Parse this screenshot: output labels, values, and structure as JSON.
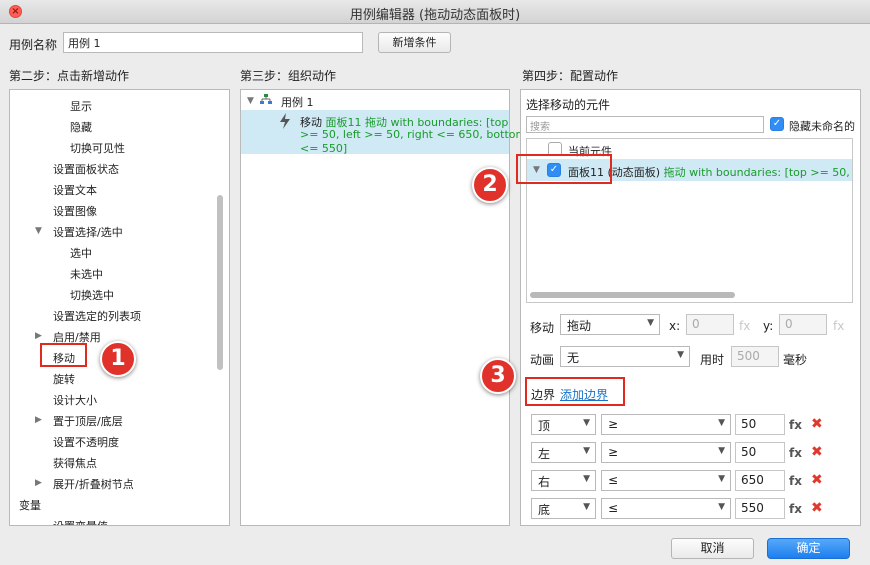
{
  "window": {
    "title": "用例编辑器 (拖动动态面板时)"
  },
  "header": {
    "name_label": "用例名称",
    "name_value": "用例 1",
    "add_condition": "新增条件"
  },
  "step2": {
    "heading": "第二步：点击新增动作",
    "items": [
      {
        "label": "显示",
        "indent": 2
      },
      {
        "label": "隐藏",
        "indent": 2
      },
      {
        "label": "切换可见性",
        "indent": 2
      },
      {
        "label": "设置面板状态",
        "indent": 1
      },
      {
        "label": "设置文本",
        "indent": 1
      },
      {
        "label": "设置图像",
        "indent": 1
      },
      {
        "label": "设置选择/选中",
        "indent": 1,
        "toggle": "expanded"
      },
      {
        "label": "选中",
        "indent": 2
      },
      {
        "label": "未选中",
        "indent": 2
      },
      {
        "label": "切换选中",
        "indent": 2
      },
      {
        "label": "设置选定的列表项",
        "indent": 1
      },
      {
        "label": "启用/禁用",
        "indent": 1,
        "toggle": "collapsed"
      },
      {
        "label": "移动",
        "indent": 1
      },
      {
        "label": "旋转",
        "indent": 1
      },
      {
        "label": "设计大小",
        "indent": 1
      },
      {
        "label": "置于顶层/底层",
        "indent": 1,
        "toggle": "collapsed"
      },
      {
        "label": "设置不透明度",
        "indent": 1
      },
      {
        "label": "获得焦点",
        "indent": 1
      },
      {
        "label": "展开/折叠树节点",
        "indent": 1,
        "toggle": "collapsed"
      },
      {
        "label": "变量",
        "indent": 0,
        "toggle": "expanded"
      },
      {
        "label": "设置变量值",
        "indent": 1
      }
    ]
  },
  "step3": {
    "heading": "第三步：组织动作",
    "case_label": "用例 1",
    "action_verb": "移动",
    "action_target": "面板11 拖动 with boundaries: [top",
    "action_line2": ">= 50, left >= 50, right <= 650, bottom",
    "action_line3": "<= 550]"
  },
  "step4": {
    "heading": "第四步：配置动作",
    "select_widget_label": "选择移动的元件",
    "search_placeholder": "搜索",
    "hide_unnamed": "隐藏未命名的",
    "current_widget": "当前元件",
    "tree_item_name": "面板11 (动态面板)",
    "tree_item_desc": "拖动 with boundaries: [top >= 50, left >= 5",
    "move_label": "移动",
    "move_value": "拖动",
    "x_label": "x:",
    "x_value": "0",
    "y_label": "y:",
    "y_value": "0",
    "fx": "fx",
    "anim_label": "动画",
    "anim_value": "无",
    "duration_label": "用时",
    "duration_value": "500",
    "duration_unit": "毫秒",
    "bounds_label": "边界",
    "add_bounds": "添加边界",
    "boundaries": [
      {
        "side": "顶",
        "op": "≥",
        "value": "50"
      },
      {
        "side": "左",
        "op": "≥",
        "value": "50"
      },
      {
        "side": "右",
        "op": "≤",
        "value": "650"
      },
      {
        "side": "底",
        "op": "≤",
        "value": "550"
      }
    ],
    "delete_glyph": "✖"
  },
  "footer": {
    "cancel": "取消",
    "ok": "确定"
  },
  "annotations": [
    "1",
    "2",
    "3"
  ]
}
